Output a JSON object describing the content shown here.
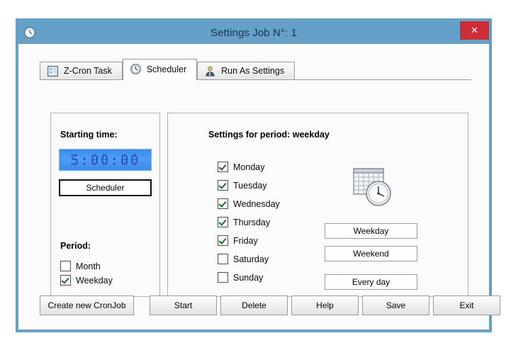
{
  "window": {
    "title": "Settings Job N°: 1",
    "title_icon": "clock-icon",
    "close_label": "✕",
    "accent_color": "#64a0c8",
    "close_color": "#cf2c35"
  },
  "tabs": [
    {
      "label": "Z-Cron Task",
      "icon": "form-window-icon",
      "active": false
    },
    {
      "label": "Scheduler",
      "icon": "clock-icon",
      "active": true
    },
    {
      "label": "Run As Settings",
      "icon": "user-icon",
      "active": false
    }
  ],
  "left_panel": {
    "starting_time_label": "Starting time:",
    "time_value": "5:00:00",
    "scheduler_button": "Scheduler",
    "period_label": "Period:",
    "period_options": [
      {
        "label": "Month",
        "checked": false
      },
      {
        "label": "Weekday",
        "checked": true
      }
    ]
  },
  "right_panel": {
    "heading": "Settings for period: weekday",
    "days": [
      {
        "label": "Monday",
        "checked": true
      },
      {
        "label": "Tuesday",
        "checked": true
      },
      {
        "label": "Wednesday",
        "checked": true
      },
      {
        "label": "Thursday",
        "checked": true
      },
      {
        "label": "Friday",
        "checked": true
      },
      {
        "label": "Saturday",
        "checked": false
      },
      {
        "label": "Sunday",
        "checked": false
      }
    ],
    "preset_buttons": [
      {
        "label": "Weekday"
      },
      {
        "label": "Weekend"
      },
      {
        "label": "Every day"
      }
    ],
    "illustration": "calendar-clock-icon"
  },
  "bottom_buttons": [
    {
      "label": "Create new CronJob"
    },
    {
      "label": "Start"
    },
    {
      "label": "Delete"
    },
    {
      "label": "Help"
    },
    {
      "label": "Save"
    },
    {
      "label": "Exit"
    }
  ]
}
